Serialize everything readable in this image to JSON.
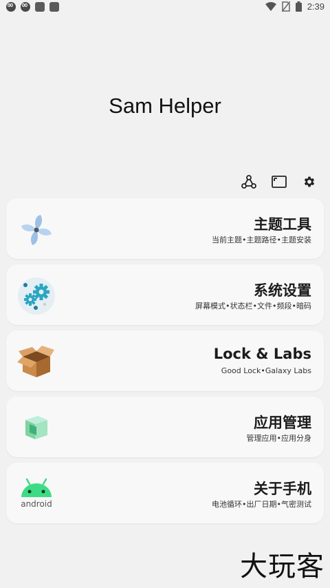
{
  "status_bar": {
    "time": "2:39",
    "left_icons": [
      "infinity-app-icon",
      "infinity-app-icon",
      "app-square-icon",
      "app-square-icon"
    ],
    "right_icons": [
      "wifi-icon",
      "no-sim-icon",
      "battery-icon"
    ]
  },
  "app": {
    "title": "Sam Helper"
  },
  "toolbar": {
    "icons": [
      "share-icon",
      "screen-icon",
      "gear-icon"
    ]
  },
  "cards": [
    {
      "title": "主题工具",
      "subtitle": "当前主题•主题路径•主题安装",
      "icon": "pinwheel-icon"
    },
    {
      "title": "系统设置",
      "subtitle": "屏幕模式•状态栏•文件•频段•暗码",
      "icon": "gears-icon"
    },
    {
      "title": "Lock & Labs",
      "subtitle": "Good Lock•Galaxy Labs",
      "icon": "box-icon"
    },
    {
      "title": "应用管理",
      "subtitle": "管理应用•应用分身",
      "icon": "cube-icon"
    },
    {
      "title": "关于手机",
      "subtitle": "电池循环•出厂日期•气密测试",
      "icon": "android-icon"
    }
  ],
  "android_logo_text": "android",
  "watermark": "大玩客",
  "colors": {
    "background": "#f1f1f1",
    "card": "#f8f8f8",
    "android_green": "#3ddc84",
    "gear_teal": "#2aa6c2",
    "pinwheel_blue": "#9dc1e6",
    "box_brown": "#c98a4a",
    "cube_green": "#7ed3a0"
  }
}
